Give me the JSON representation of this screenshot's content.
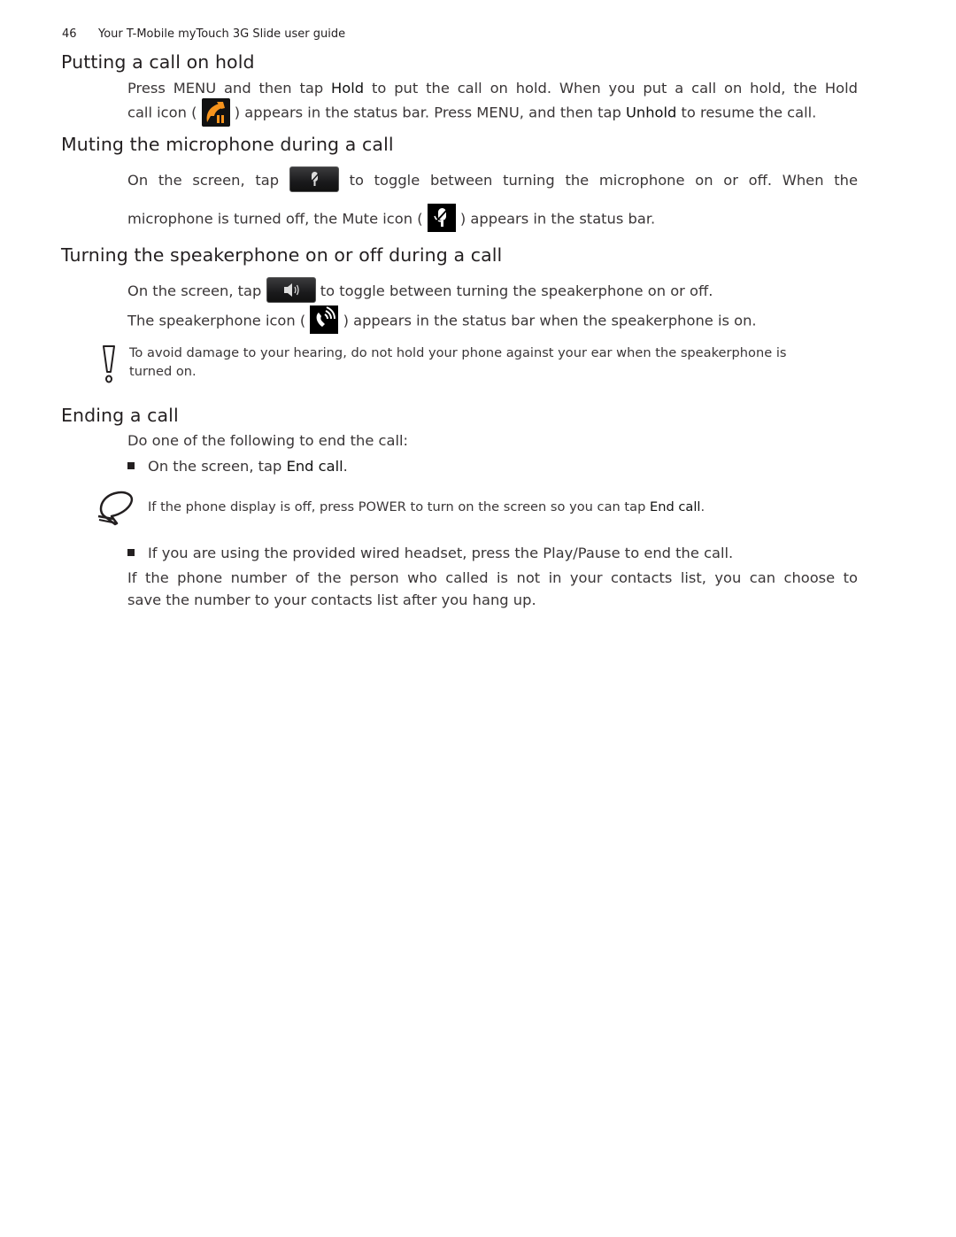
{
  "header": {
    "page_number": "46",
    "title": "Your T-Mobile myTouch 3G Slide user guide"
  },
  "sections": {
    "hold": {
      "heading": "Putting a call on hold",
      "p1_a": "Press MENU and then tap ",
      "p1_b": "Hold",
      "p1_c": " to put the call on hold. When you put a call on hold, the Hold",
      "p2_a": "call icon ( ",
      "p2_icon": "hold-call-icon",
      "p2_b": " ) appears in the status bar. Press MENU, and then tap ",
      "p2_c": "Unhold",
      "p2_d": " to resume the call."
    },
    "mute": {
      "heading": "Muting the microphone during a call",
      "p1_a": "On the screen, tap ",
      "p1_icon": "mute-button-icon",
      "p1_b": " to toggle between turning the microphone on or off. When the",
      "p2_a": "microphone is turned off, the Mute icon ( ",
      "p2_icon": "mute-status-icon",
      "p2_b": " ) appears in the status bar."
    },
    "speaker": {
      "heading": "Turning the speakerphone on or off during a call",
      "p1_a": "On the screen, tap ",
      "p1_icon": "speaker-button-icon",
      "p1_b": " to toggle between turning the speakerphone on or off.",
      "p2_a": "The speakerphone icon ( ",
      "p2_icon": "speakerphone-status-icon",
      "p2_b": " ) appears in the status bar when the speakerphone is on.",
      "warning_icon": "warning-exclamation-icon",
      "warning_line1": "To avoid damage to your hearing, do not hold your phone against your ear when the speakerphone is",
      "warning_line2": "turned on."
    },
    "ending": {
      "heading": "Ending a call",
      "intro": "Do one of the following to end the call:",
      "bullet1_a": "On the screen, tap ",
      "bullet1_b": "End call",
      "bullet1_c": ".",
      "tip_icon": "tip-speech-bubble-icon",
      "tip_a": "If the phone display is off, press POWER to turn on the screen so you can tap ",
      "tip_b": "End call",
      "tip_c": ".",
      "bullet2": "If you are using the provided wired headset, press the Play/Pause to end the call.",
      "outro_line1": "If the phone number of the person who called is not in your contacts list, you can choose to",
      "outro_line2": "save the number to your contacts list after you hang up."
    }
  },
  "colors": {
    "text": "#231f20",
    "hold_icon_accent": "#f7941d"
  }
}
